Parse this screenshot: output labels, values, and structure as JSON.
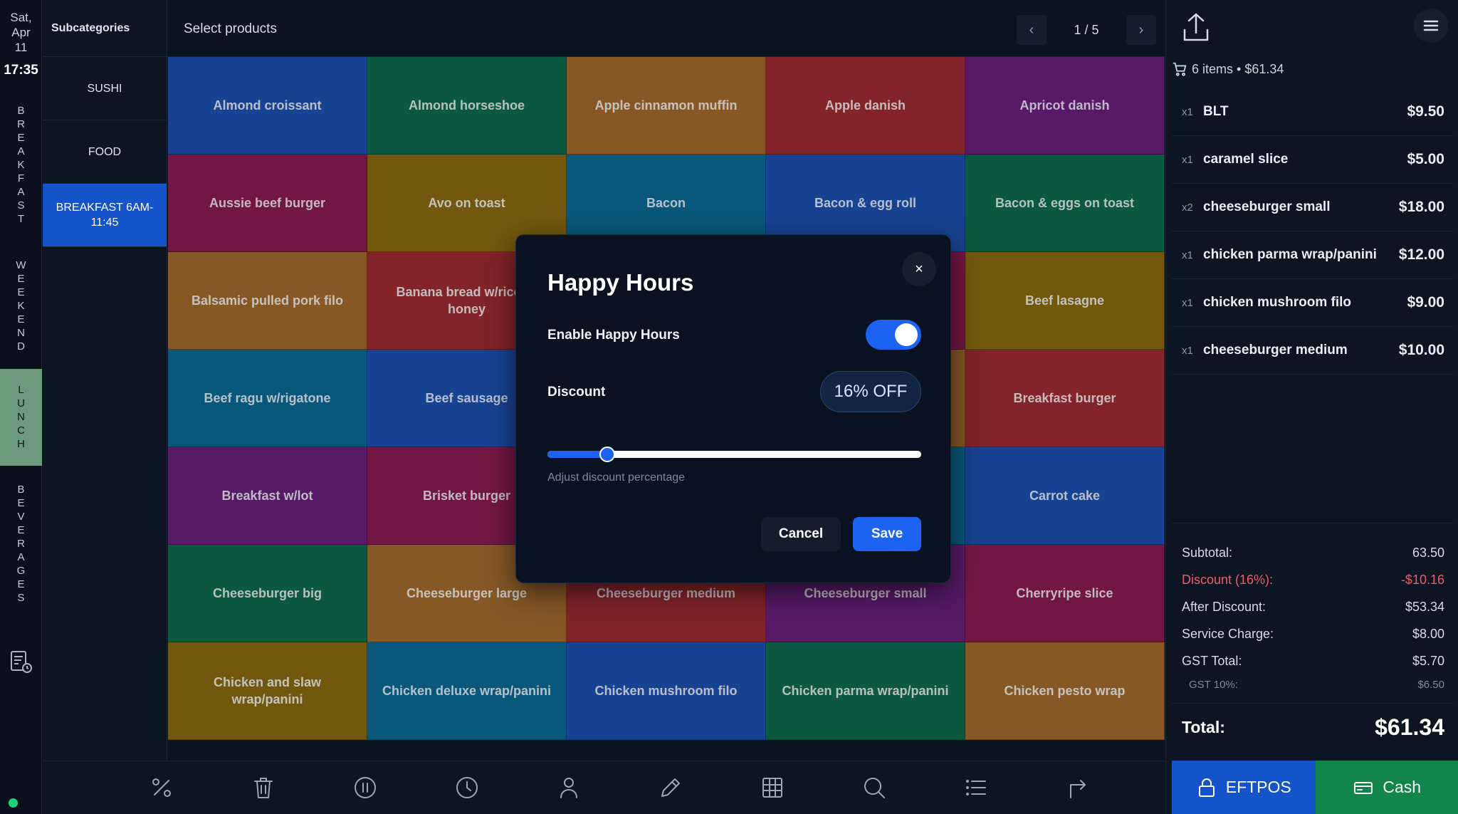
{
  "clock": {
    "day": "Sat,",
    "month": "Apr",
    "date": "11",
    "time": "17:35"
  },
  "menus": [
    {
      "label": "BREAKFAST",
      "active": false
    },
    {
      "label": "WEEKEND",
      "active": false
    },
    {
      "label": "LUNCH",
      "active": true
    },
    {
      "label": "BEVERAGES",
      "active": false
    }
  ],
  "subcategories": {
    "title": "Subcategories",
    "items": [
      {
        "label": "SUSHI",
        "active": false
      },
      {
        "label": "FOOD",
        "active": false
      },
      {
        "label": "BREAKFAST 6AM-11:45",
        "active": true
      }
    ]
  },
  "products_header": {
    "title": "Select products",
    "page": "1 / 5",
    "prev": "‹",
    "next": "›"
  },
  "products": [
    {
      "name": "Almond croissant",
      "color": "#1d4fae"
    },
    {
      "name": "Almond horseshoe",
      "color": "#0f6a4a"
    },
    {
      "name": "Apple cinnamon muffin",
      "color": "#a2692a"
    },
    {
      "name": "Apple danish",
      "color": "#9e2a2e"
    },
    {
      "name": "Apricot danish",
      "color": "#6a1e79"
    },
    {
      "name": "Aussie beef burger",
      "color": "#8a1a4e"
    },
    {
      "name": "Avo on toast",
      "color": "#8a6a0e"
    },
    {
      "name": "Bacon",
      "color": "#0a6a92"
    },
    {
      "name": "Bacon & egg roll",
      "color": "#1d4fae"
    },
    {
      "name": "Bacon & eggs on toast",
      "color": "#0f6a4a"
    },
    {
      "name": "Balsamic pulled pork filo",
      "color": "#a2692a"
    },
    {
      "name": "Banana bread w/ricotta honey",
      "color": "#9e2a2e"
    },
    {
      "name": "",
      "color": "#6a1e79"
    },
    {
      "name": "",
      "color": "#8a1a4e"
    },
    {
      "name": "Beef lasagne",
      "color": "#8a6a0e"
    },
    {
      "name": "Beef ragu w/rigatone",
      "color": "#0a6a92"
    },
    {
      "name": "Beef sausage",
      "color": "#1d4fae"
    },
    {
      "name": "",
      "color": "#0f6a4a"
    },
    {
      "name": "",
      "color": "#a2692a"
    },
    {
      "name": "Breakfast burger",
      "color": "#9e2a2e"
    },
    {
      "name": "Breakfast w/lot",
      "color": "#6a1e79"
    },
    {
      "name": "Brisket burger",
      "color": "#8a1a4e"
    },
    {
      "name": "",
      "color": "#8a6a0e"
    },
    {
      "name": "",
      "color": "#0a6a92"
    },
    {
      "name": "Carrot cake",
      "color": "#1d4fae"
    },
    {
      "name": "Cheeseburger big",
      "color": "#0f6a4a"
    },
    {
      "name": "Cheeseburger large",
      "color": "#a2692a"
    },
    {
      "name": "Cheeseburger medium",
      "color": "#9e2a2e"
    },
    {
      "name": "Cheeseburger small",
      "color": "#6a1e79"
    },
    {
      "name": "Cherryripe slice",
      "color": "#8a1a4e"
    },
    {
      "name": "Chicken and slaw wrap/panini",
      "color": "#8a6a0e"
    },
    {
      "name": "Chicken deluxe wrap/panini",
      "color": "#0a6a92"
    },
    {
      "name": "Chicken mushroom filo",
      "color": "#1d4fae"
    },
    {
      "name": "Chicken parma wrap/panini",
      "color": "#0f6a4a"
    },
    {
      "name": "Chicken pesto wrap",
      "color": "#a2692a"
    }
  ],
  "dialog": {
    "title": "Happy Hours",
    "close": "×",
    "enable_label": "Enable Happy Hours",
    "enabled": true,
    "discount_label": "Discount",
    "discount_pill": "16% OFF",
    "discount_percent": 16,
    "slider_hint": "Adjust discount percentage",
    "cancel": "Cancel",
    "save": "Save"
  },
  "cart": {
    "summary": "6 items • $61.34",
    "items": [
      {
        "qty": "x1",
        "name": "BLT",
        "price": "$9.50"
      },
      {
        "qty": "x1",
        "name": "caramel slice",
        "price": "$5.00"
      },
      {
        "qty": "x2",
        "name": "cheeseburger small",
        "price": "$18.00"
      },
      {
        "qty": "x1",
        "name": "chicken parma wrap/panini",
        "price": "$12.00"
      },
      {
        "qty": "x1",
        "name": "chicken mushroom filo",
        "price": "$9.00"
      },
      {
        "qty": "x1",
        "name": "cheeseburger medium",
        "price": "$10.00"
      }
    ],
    "totals": {
      "subtotal_label": "Subtotal:",
      "subtotal": "63.50",
      "discount_label": "Discount (16%):",
      "discount": "-$10.16",
      "after_label": "After Discount:",
      "after": "$53.34",
      "service_label": "Service Charge:",
      "service": "$8.00",
      "gst_label": "GST Total:",
      "gst": "$5.70",
      "gst10_label": "GST 10%:",
      "gst10": "$6.50",
      "total_label": "Total:",
      "total": "$61.34"
    },
    "pay": {
      "eftpos": "EFTPOS",
      "cash": "Cash"
    }
  },
  "colors": {
    "accent": "#1b63f0",
    "active_menu": "#6b9b7c",
    "discount_red": "#f05c6a",
    "cash_green": "#12864a"
  },
  "icons": [
    "percent-icon",
    "trash-icon",
    "pause-icon",
    "clock-icon",
    "user-icon",
    "pencil-icon",
    "table-icon",
    "search-icon",
    "list-icon",
    "redirect-icon"
  ]
}
